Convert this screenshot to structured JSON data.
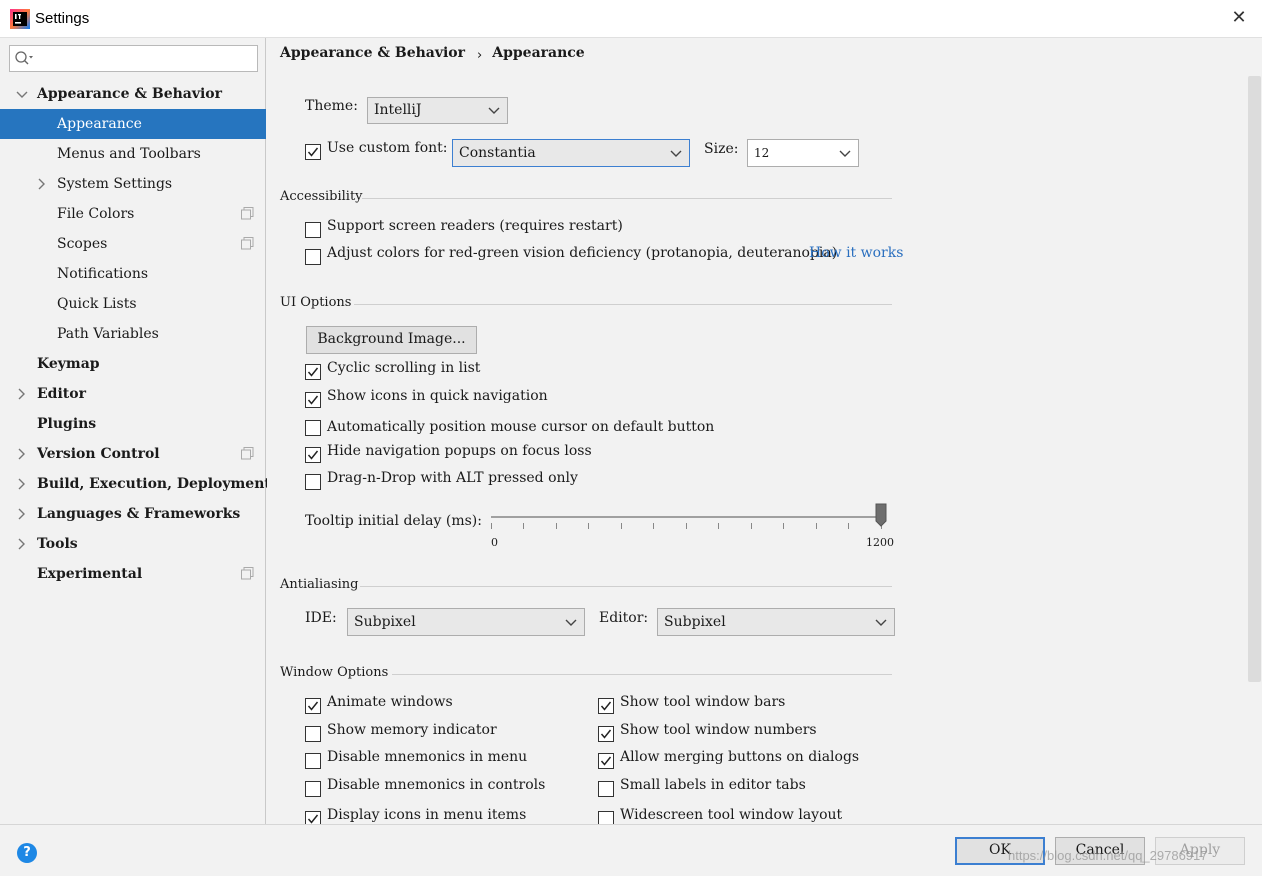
{
  "window": {
    "title": "Settings"
  },
  "sidebar": {
    "search_placeholder": "",
    "items": [
      {
        "label": "Appearance & Behavior"
      },
      {
        "label": "Appearance"
      },
      {
        "label": "Menus and Toolbars"
      },
      {
        "label": "System Settings"
      },
      {
        "label": "File Colors"
      },
      {
        "label": "Scopes"
      },
      {
        "label": "Notifications"
      },
      {
        "label": "Quick Lists"
      },
      {
        "label": "Path Variables"
      },
      {
        "label": "Keymap"
      },
      {
        "label": "Editor"
      },
      {
        "label": "Plugins"
      },
      {
        "label": "Version Control"
      },
      {
        "label": "Build, Execution, Deployment"
      },
      {
        "label": "Languages & Frameworks"
      },
      {
        "label": "Tools"
      },
      {
        "label": "Experimental"
      }
    ]
  },
  "breadcrumb": {
    "parent": "Appearance & Behavior",
    "current": "Appearance"
  },
  "appearance": {
    "theme_label": "Theme:",
    "theme_value": "IntelliJ",
    "custom_font_label": "Use custom font:",
    "custom_font_checked": true,
    "font_value": "Constantia",
    "size_label": "Size:",
    "size_value": "12"
  },
  "accessibility": {
    "title": "Accessibility",
    "screen_readers": "Support screen readers (requires restart)",
    "screen_readers_checked": false,
    "red_green": "Adjust colors for red-green vision deficiency (protanopia, deuteranopia)",
    "red_green_checked": false,
    "how_it_works": "How it works"
  },
  "ui_options": {
    "title": "UI Options",
    "background_image_button": "Background Image...",
    "options": [
      {
        "label": "Cyclic scrolling in list",
        "checked": true
      },
      {
        "label": "Show icons in quick navigation",
        "checked": true
      },
      {
        "label": "Automatically position mouse cursor on default button",
        "checked": false
      },
      {
        "label": "Hide navigation popups on focus loss",
        "checked": true
      },
      {
        "label": "Drag-n-Drop with ALT pressed only",
        "checked": false
      }
    ],
    "tooltip_label": "Tooltip initial delay (ms):",
    "tooltip_min": "0",
    "tooltip_max": "1200",
    "tooltip_value": 1200
  },
  "antialiasing": {
    "title": "Antialiasing",
    "ide_label": "IDE:",
    "ide_value": "Subpixel",
    "editor_label": "Editor:",
    "editor_value": "Subpixel"
  },
  "window_options": {
    "title": "Window Options",
    "left": [
      {
        "label": "Animate windows",
        "checked": true
      },
      {
        "label": "Show memory indicator",
        "checked": false
      },
      {
        "label": "Disable mnemonics in menu",
        "checked": false
      },
      {
        "label": "Disable mnemonics in controls",
        "checked": false
      },
      {
        "label": "Display icons in menu items",
        "checked": true
      }
    ],
    "right": [
      {
        "label": "Show tool window bars",
        "checked": true
      },
      {
        "label": "Show tool window numbers",
        "checked": true
      },
      {
        "label": "Allow merging buttons on dialogs",
        "checked": true
      },
      {
        "label": "Small labels in editor tabs",
        "checked": false
      },
      {
        "label": "Widescreen tool window layout",
        "checked": false
      }
    ]
  },
  "footer": {
    "ok": "OK",
    "cancel": "Cancel",
    "apply": "Apply",
    "help": "?",
    "watermark": "https://blog.csdn.net/qq_29786917"
  },
  "colors": {
    "selection": "#2675bf",
    "link": "#2a6fbf",
    "help": "#1e88e5"
  }
}
